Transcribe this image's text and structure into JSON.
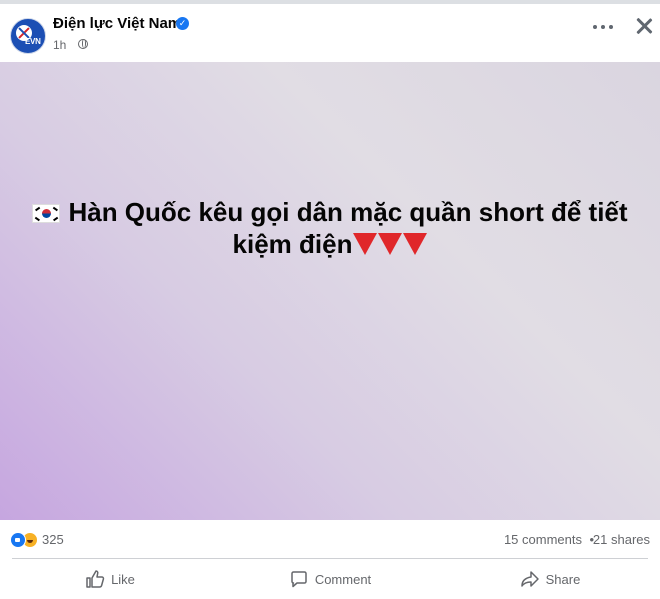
{
  "header": {
    "page_name": "Điện lực Việt Nam",
    "verified_icon": "verified-badge-icon",
    "time": "1h",
    "privacy_icon": "globe-icon",
    "more_icon": "more-horizontal-icon",
    "close_icon": "close-icon",
    "avatar_text": "EVN"
  },
  "post": {
    "flag_icon": "south-korea-flag-icon",
    "text": "Hàn Quốc kêu gọi dân mặc quần short để tiết kiệm điện",
    "trailing_icons": [
      "red-triangle-down-icon",
      "red-triangle-down-icon",
      "red-triangle-down-icon"
    ],
    "background_colors": [
      "#c6a6e0",
      "#e1dde4"
    ]
  },
  "stats": {
    "reaction_icons": [
      "like-reaction-icon",
      "haha-reaction-icon"
    ],
    "reaction_count": "325",
    "comments": "15 comments",
    "separator": "•",
    "shares": "21 shares"
  },
  "actions": {
    "like": "Like",
    "comment": "Comment",
    "share": "Share"
  },
  "colors": {
    "accent": "#1877f2",
    "secondary_text": "#65676b"
  }
}
